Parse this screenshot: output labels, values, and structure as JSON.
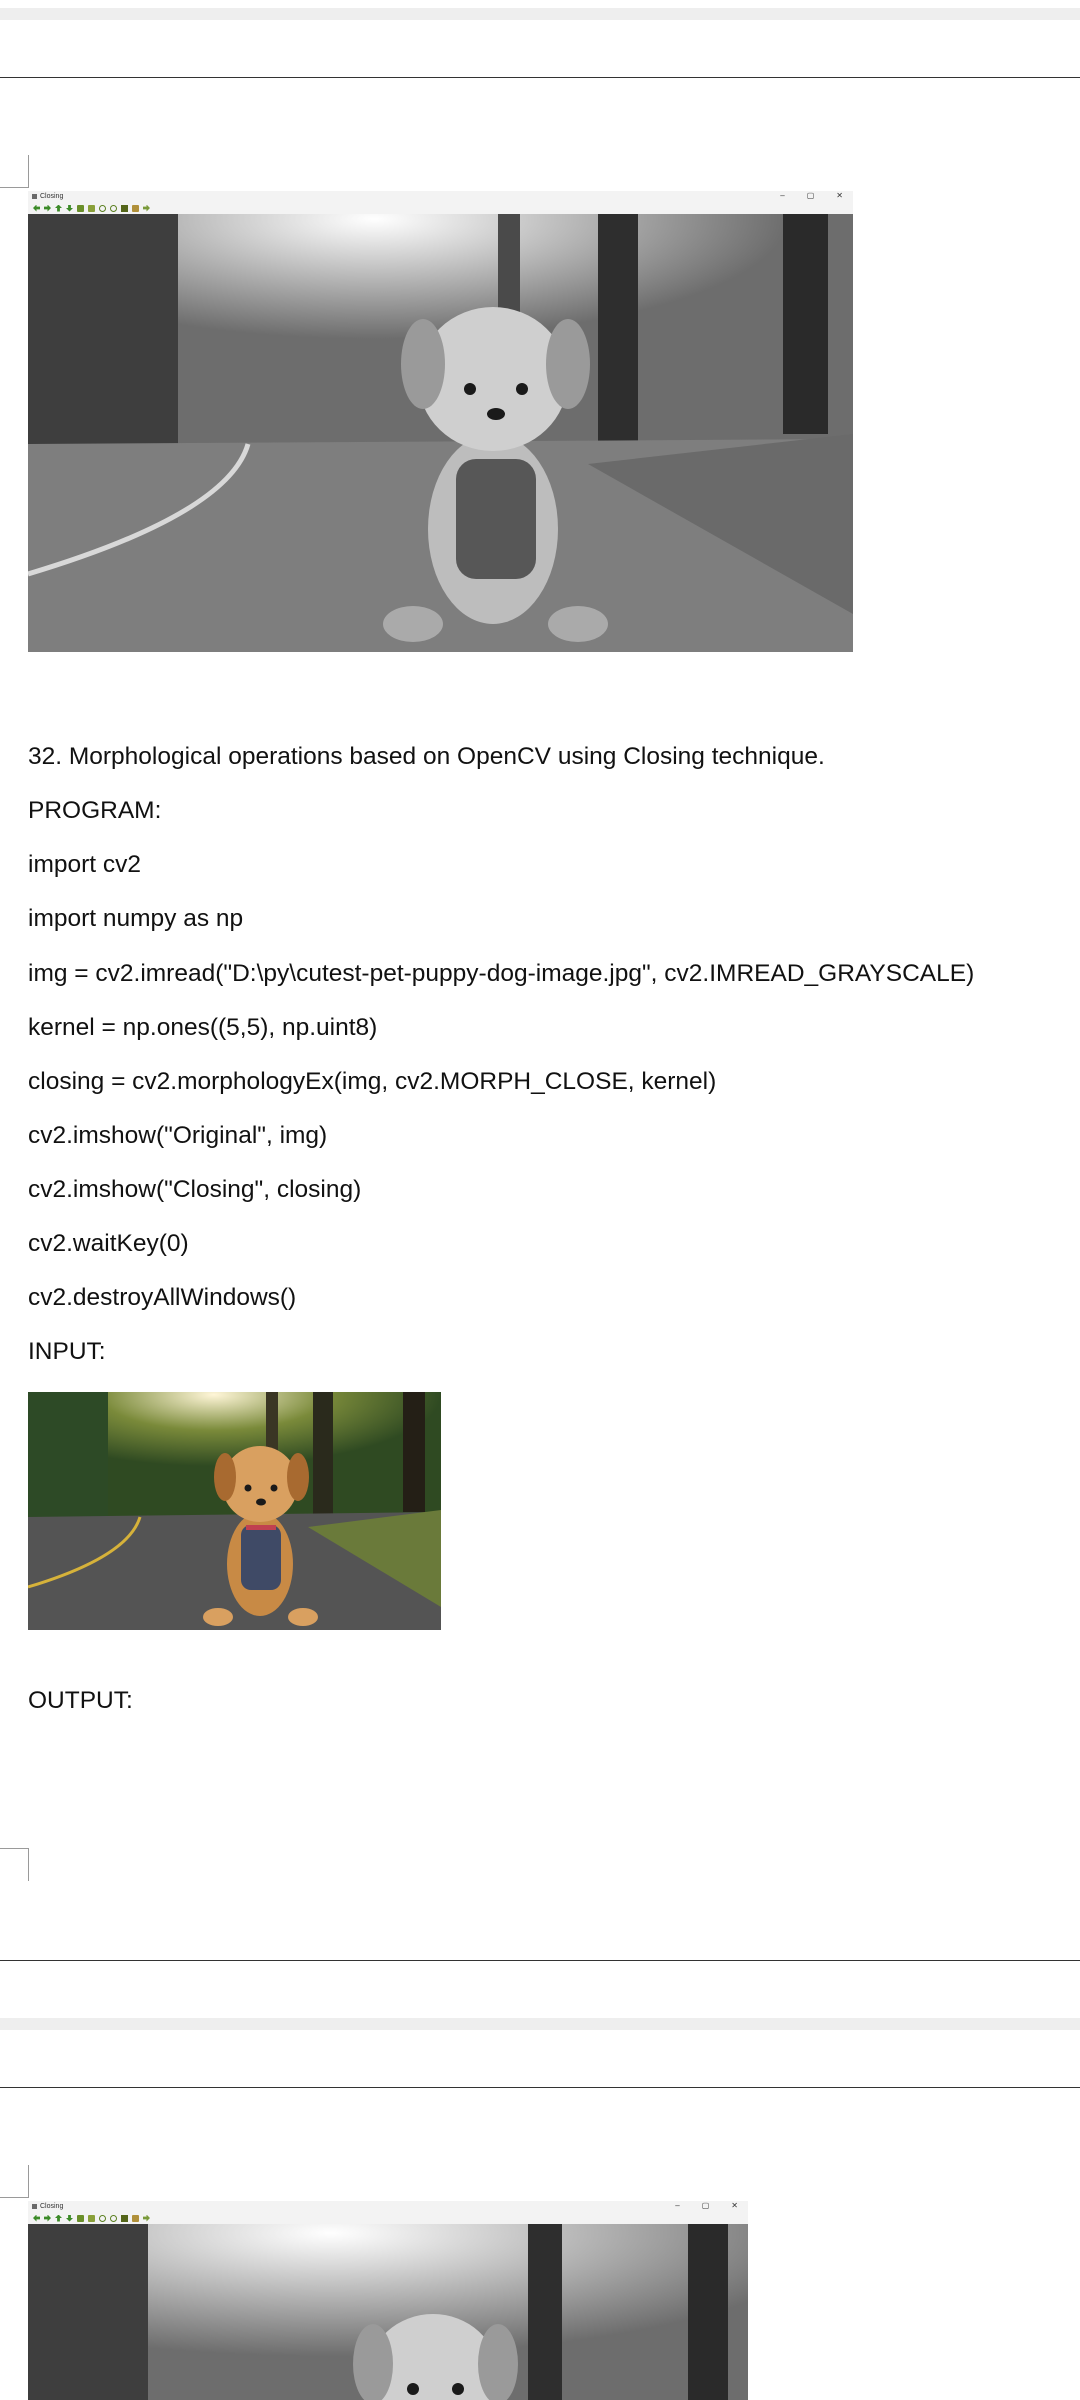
{
  "output_window_top": {
    "title": "Closing",
    "controls": [
      "–",
      "▢",
      "✕"
    ],
    "toolbar_icons": [
      "arrow-left-icon",
      "arrow-right-icon",
      "arrow-up-icon",
      "arrow-down-icon",
      "image-icon",
      "properties-icon",
      "zoom-in-icon",
      "zoom-out-icon",
      "save-icon",
      "copy-icon",
      "settings-icon"
    ]
  },
  "document": {
    "heading": "32. Morphological operations based on OpenCV using Closing technique.",
    "program_label": "PROGRAM:",
    "code_lines": [
      "import cv2",
      "import numpy as np",
      "img = cv2.imread(\"D:\\py\\cutest-pet-puppy-dog-image.jpg\", cv2.IMREAD_GRAYSCALE)",
      "kernel = np.ones((5,5), np.uint8)",
      "closing = cv2.morphologyEx(img, cv2.MORPH_CLOSE, kernel)",
      "cv2.imshow(\"Original\", img)",
      "cv2.imshow(\"Closing\", closing)",
      "cv2.waitKey(0)",
      "cv2.destroyAllWindows()"
    ],
    "input_label": "INPUT:",
    "output_label": "OUTPUT:"
  },
  "output_window_bottom": {
    "title": "Closing",
    "controls": [
      "–",
      "▢",
      "✕"
    ]
  },
  "colors": {
    "page_gap": "#eeeeee",
    "rule": "#333333",
    "toolbar_icon": "#3b8a27"
  }
}
